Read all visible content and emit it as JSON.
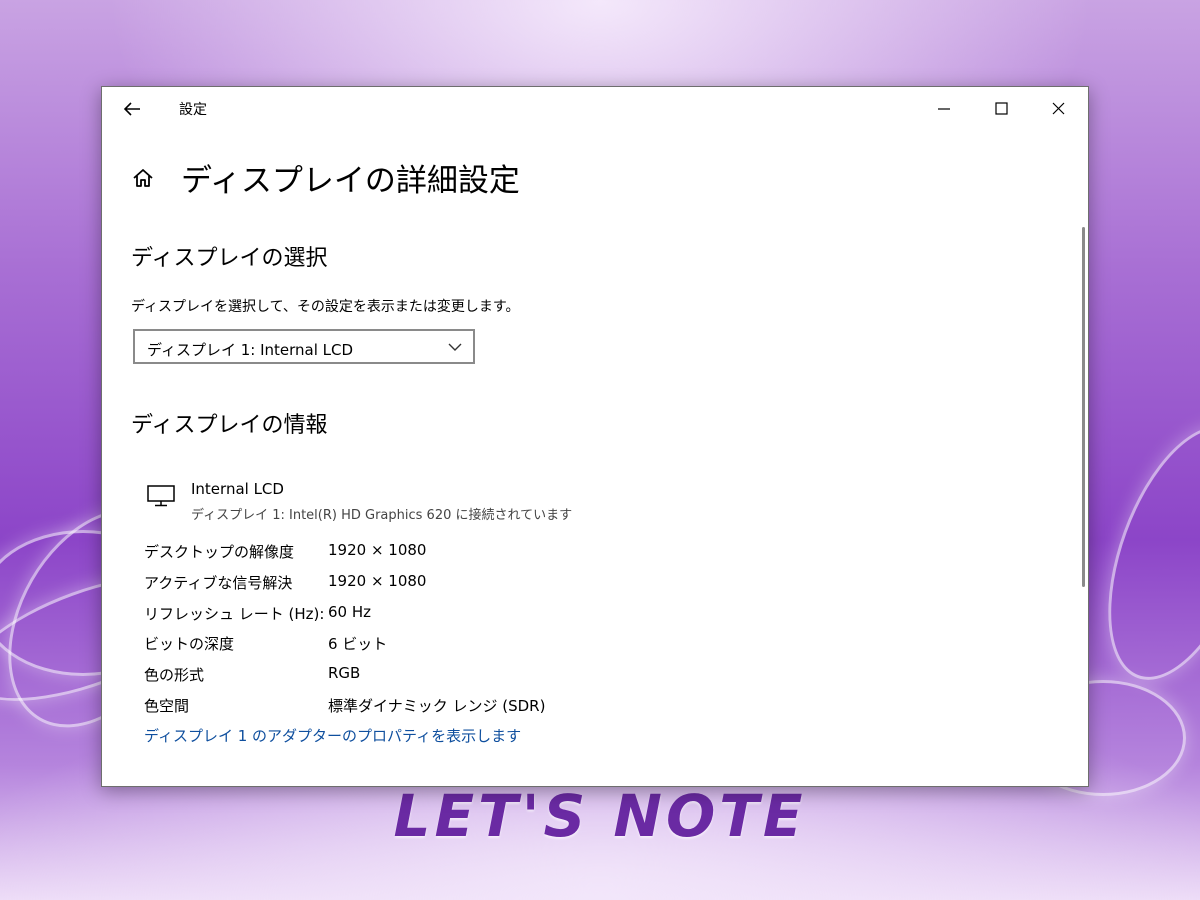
{
  "window": {
    "title": "設定"
  },
  "page": {
    "title": "ディスプレイの詳細設定"
  },
  "selection": {
    "heading": "ディスプレイの選択",
    "description": "ディスプレイを選択して、その設定を表示または変更します。",
    "dropdown_value": "ディスプレイ 1: Internal LCD"
  },
  "info": {
    "heading": "ディスプレイの情報",
    "display_name": "Internal LCD",
    "display_connection": "ディスプレイ 1: Intel(R) HD Graphics 620 に接続されています",
    "rows": [
      {
        "label": "デスクトップの解像度",
        "value": "1920 × 1080"
      },
      {
        "label": "アクティブな信号解決",
        "value": "1920 × 1080"
      },
      {
        "label": "リフレッシュ レート (Hz):",
        "value": "60 Hz"
      },
      {
        "label": "ビットの深度",
        "value": "6 ビット"
      },
      {
        "label": "色の形式",
        "value": "RGB"
      },
      {
        "label": "色空間",
        "value": "標準ダイナミック レンジ (SDR)"
      }
    ],
    "adapter_link": "ディスプレイ 1 のアダプターのプロパティを表示します"
  },
  "wallpaper": {
    "brand_text": "LET'S NOTE"
  },
  "icons": {
    "back": "back-arrow-icon",
    "home": "home-icon",
    "minimize": "minimize-icon",
    "maximize": "maximize-icon",
    "close": "close-icon",
    "chevron": "chevron-down-icon",
    "monitor": "monitor-icon"
  },
  "colors": {
    "link": "#0f4f9e",
    "window_bg": "#ffffff",
    "wallpaper_accent": "#8c45c8"
  }
}
